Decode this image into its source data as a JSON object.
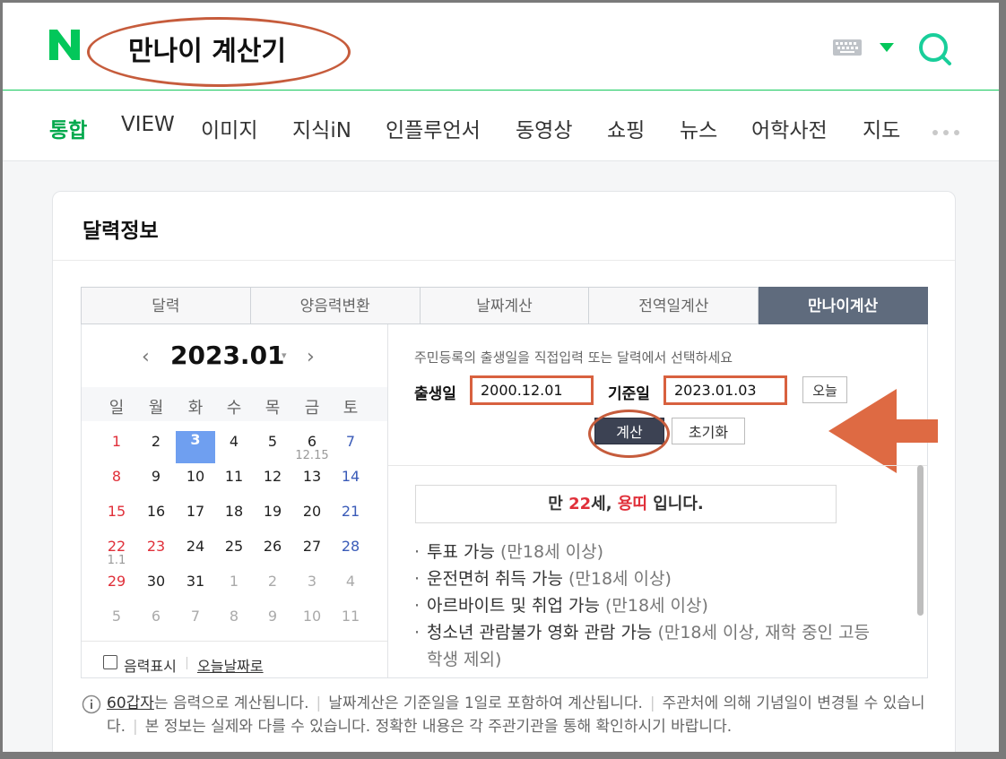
{
  "header": {
    "logo_letter": "N",
    "query": "만나이 계산기"
  },
  "nav": {
    "items": [
      "통합",
      "VIEW",
      "이미지",
      "지식iN",
      "인플루언서",
      "동영상",
      "쇼핑",
      "뉴스",
      "어학사전",
      "지도"
    ],
    "active": "통합"
  },
  "card": {
    "title": "달력정보",
    "tabs": [
      "달력",
      "양음력변환",
      "날짜계산",
      "전역일계산",
      "만나이계산"
    ],
    "active_tab": "만나이계산"
  },
  "calendar": {
    "prev": "‹",
    "next": "›",
    "month_label": "2023.01",
    "dropdown": "▾",
    "weekdays": [
      "일",
      "월",
      "화",
      "수",
      "목",
      "금",
      "토"
    ],
    "weeks": [
      [
        "1",
        "2",
        "3",
        "4",
        "5",
        "6",
        "7"
      ],
      [
        "8",
        "9",
        "10",
        "11",
        "12",
        "13",
        "14"
      ],
      [
        "15",
        "16",
        "17",
        "18",
        "19",
        "20",
        "21"
      ],
      [
        "22",
        "23",
        "24",
        "25",
        "26",
        "27",
        "28"
      ],
      [
        "29",
        "30",
        "31",
        "1",
        "2",
        "3",
        "4"
      ],
      [
        "5",
        "6",
        "7",
        "8",
        "9",
        "10",
        "11"
      ]
    ],
    "today": "3",
    "lunar_labels": [
      "12.15",
      "1.1"
    ],
    "lunar_toggle": "음력표시",
    "today_link": "오늘날짜로"
  },
  "calculator": {
    "instruction": "주민등록의 출생일을 직접입력 또는 달력에서 선택하세요",
    "birth_label": "출생일",
    "birth_value": "2000.12.01",
    "base_label": "기준일",
    "base_value": "2023.01.03",
    "today_button": "오늘",
    "calc_button": "계산",
    "reset_button": "초기화"
  },
  "result": {
    "prefix": "만 ",
    "age": "22",
    "age_suffix": "세, ",
    "zodiac": "용띠",
    "suffix": " 입니다.",
    "bullets": [
      {
        "text": "투표 가능",
        "note": "(만18세 이상)"
      },
      {
        "text": "운전면허 취득 가능",
        "note": "(만18세 이상)"
      },
      {
        "text": "아르바이트 및 취업 가능",
        "note": "(만18세 이상)"
      },
      {
        "text": "청소년 관람불가 영화 관람 가능",
        "note": "(만18세 이상, 재학 중인 고등"
      },
      {
        "text": "",
        "note": "학생 제외)"
      }
    ]
  },
  "footer_note": {
    "link": "60갑자",
    "part1": "는 음력으로 계산됩니다.",
    "part2": "날짜계산은 기준일을 1일로 포함하여 계산됩니다.",
    "part3": "주관처에 의해 기념일이 변경될 수 있습니다.",
    "part4": "본 정보는 실제와 다를 수 있습니다. 정확한 내용은 각 주관기관을 통해 확인하시기 바랍니다."
  },
  "colors": {
    "brand": "#03c75a",
    "active_tab": "#5f6b7d",
    "annotation": "#d8613f",
    "sunday": "#e0303a",
    "saturday": "#3a5bb8",
    "today": "#6f9ff0"
  }
}
